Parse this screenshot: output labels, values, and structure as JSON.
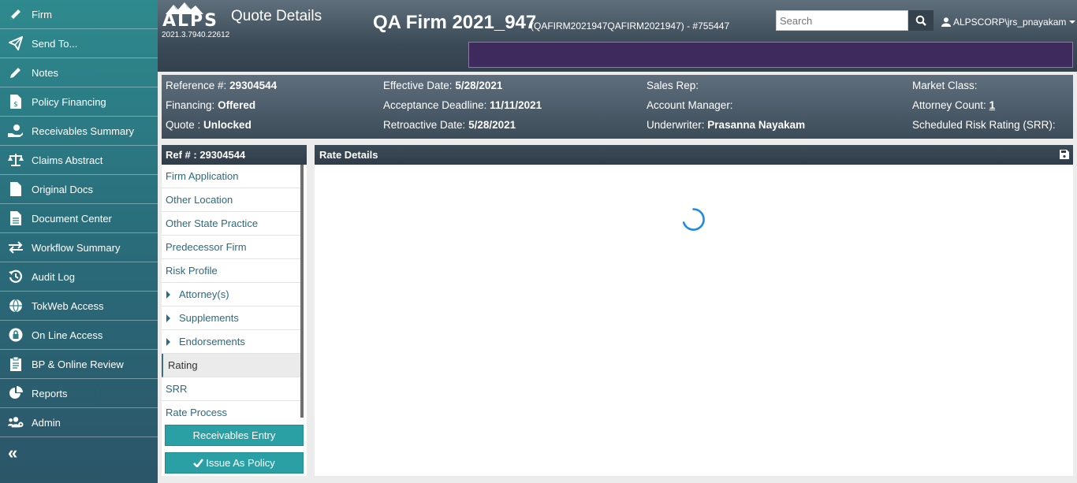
{
  "sidebar": {
    "items": [
      {
        "label": "Firm",
        "icon": "pencil-icon"
      },
      {
        "label": "Send To...",
        "icon": "paper-plane-icon"
      },
      {
        "label": "Notes",
        "icon": "pencil-icon"
      },
      {
        "label": "Policy Financing",
        "icon": "invoice-dollar-icon"
      },
      {
        "label": "Receivables Summary",
        "icon": "hand-holding-dollar-icon"
      },
      {
        "label": "Claims Abstract",
        "icon": "balance-scale-icon"
      },
      {
        "label": "Original Docs",
        "icon": "file-icon"
      },
      {
        "label": "Document Center",
        "icon": "file-text-icon"
      },
      {
        "label": "Workflow Summary",
        "icon": "exchange-arrows-icon"
      },
      {
        "label": "Audit Log",
        "icon": "history-icon"
      },
      {
        "label": "TokWeb Access",
        "icon": "globe-icon"
      },
      {
        "label": "On Line Access",
        "icon": "lock-icon"
      },
      {
        "label": "BP & Online Review",
        "icon": "clipboard-icon"
      },
      {
        "label": "Reports",
        "icon": "pie-chart-icon"
      },
      {
        "label": "Admin",
        "icon": "users-cog-icon"
      }
    ],
    "collapse_glyph": "«"
  },
  "header": {
    "logo_text": "ALPS",
    "version": "2021.3.7940.22612",
    "page_title": "Quote Details",
    "firm_name": "QA Firm 2021_947",
    "firm_sub": "(QAFIRM2021947QAFIRM2021947) - #755447",
    "search_placeholder": "Search",
    "user": "ALPSCORP\\jrs_pnayakam"
  },
  "info": {
    "reference_label": "Reference #:",
    "reference_value": "29304544",
    "financing_label": "Financing:",
    "financing_value": "Offered",
    "quote_label": "Quote :",
    "quote_value": "Unlocked",
    "effective_label": "Effective Date:",
    "effective_value": "5/28/2021",
    "acceptance_label": "Acceptance Deadline:",
    "acceptance_value": "11/11/2021",
    "retro_label": "Retroactive Date:",
    "retro_value": "5/28/2021",
    "sales_label": "Sales Rep:",
    "sales_value": "",
    "account_label": "Account Manager:",
    "account_value": "",
    "underwriter_label": "Underwriter:",
    "underwriter_value": "Prasanna Nayakam",
    "market_label": "Market Class:",
    "market_value": "",
    "attorney_label": "Attorney Count:",
    "attorney_value": "1",
    "srr_label": "Scheduled Risk Rating (SRR):",
    "srr_value": ""
  },
  "subnav": {
    "title": "Ref # : 29304544",
    "items": [
      {
        "label": "Firm Application",
        "expandable": false
      },
      {
        "label": "Other Location",
        "expandable": false
      },
      {
        "label": "Other State Practice",
        "expandable": false
      },
      {
        "label": "Predecessor Firm",
        "expandable": false
      },
      {
        "label": "Risk Profile",
        "expandable": false
      },
      {
        "label": "Attorney(s)",
        "expandable": true
      },
      {
        "label": "Supplements",
        "expandable": true
      },
      {
        "label": "Endorsements",
        "expandable": true
      },
      {
        "label": "Rating",
        "expandable": false,
        "active": true
      },
      {
        "label": "SRR",
        "expandable": false
      },
      {
        "label": "Rate Process",
        "expandable": false
      }
    ],
    "receivables_button": "Receivables Entry",
    "issue_button": "Issue As Policy"
  },
  "main": {
    "title": "Rate Details"
  },
  "colors": {
    "accent": "#2aa0a4",
    "link": "#2a6b80",
    "spinner": "#1e88e5",
    "banner": "#3f2a5e"
  }
}
